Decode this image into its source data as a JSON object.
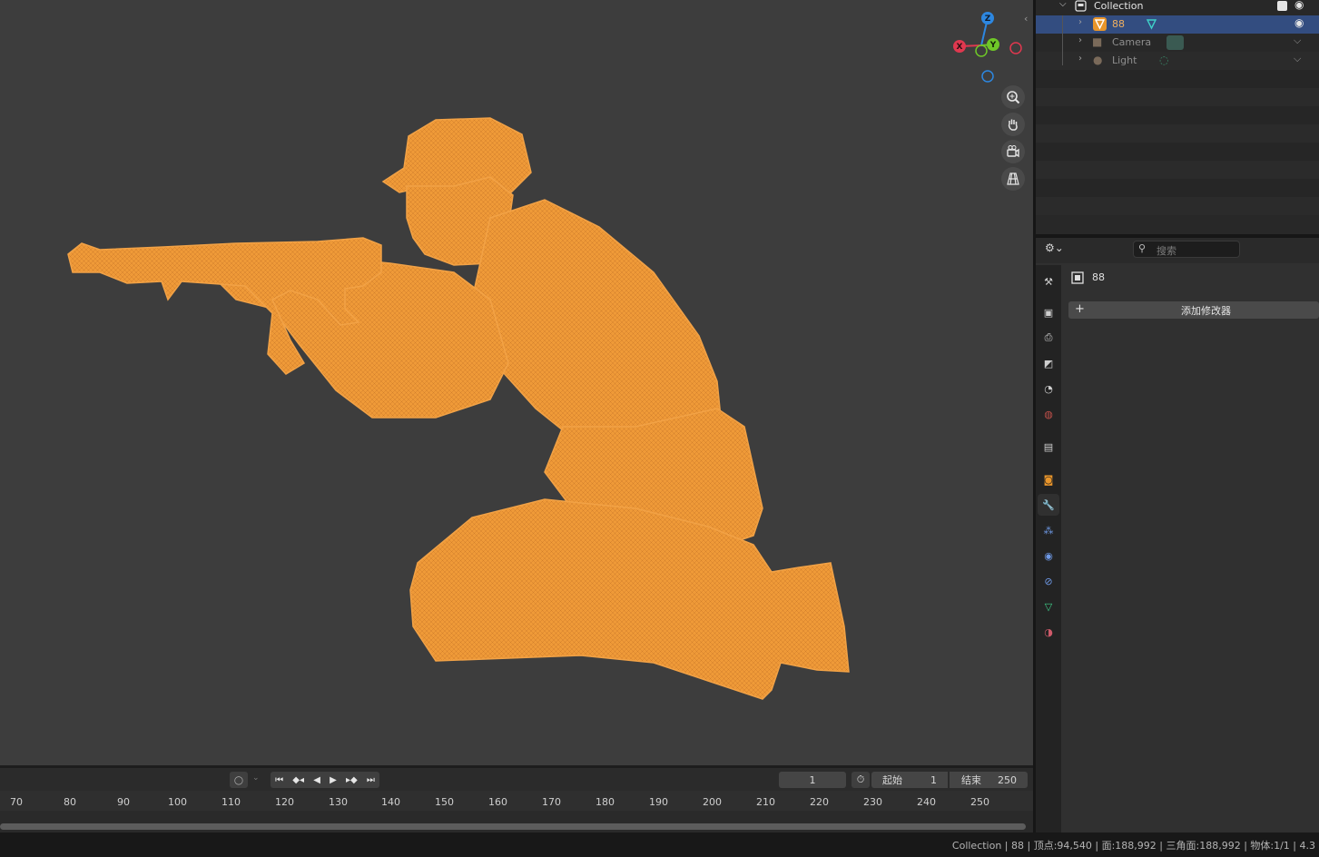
{
  "outliner": {
    "collection_label": "Collection",
    "items": [
      {
        "label": "88"
      },
      {
        "label": "Camera"
      },
      {
        "label": "Light"
      }
    ]
  },
  "properties": {
    "search_placeholder": "搜索",
    "object_name": "88",
    "add_modifier_label": "添加修改器",
    "active_tab": "modifier"
  },
  "timeline": {
    "current_frame": "1",
    "start_label": "起始",
    "start_value": "1",
    "end_label": "结束",
    "end_value": "250",
    "ruler": [
      "70",
      "80",
      "90",
      "100",
      "110",
      "120",
      "130",
      "140",
      "150",
      "160",
      "170",
      "180",
      "190",
      "200",
      "210",
      "220",
      "230",
      "240",
      "250"
    ]
  },
  "gizmo": {
    "x": "X",
    "y": "Y",
    "z": "Z"
  },
  "status": {
    "text": "Collection | 88 | 顶点:94,540 | 面:188,992 | 三角面:188,992 | 物体:1/1 | 4.3"
  },
  "colors": {
    "selection": "#e8952b",
    "axis_x": "#e0384f",
    "axis_y": "#6fc828",
    "axis_z": "#2d87e0",
    "outliner_selected": "#334d80"
  }
}
